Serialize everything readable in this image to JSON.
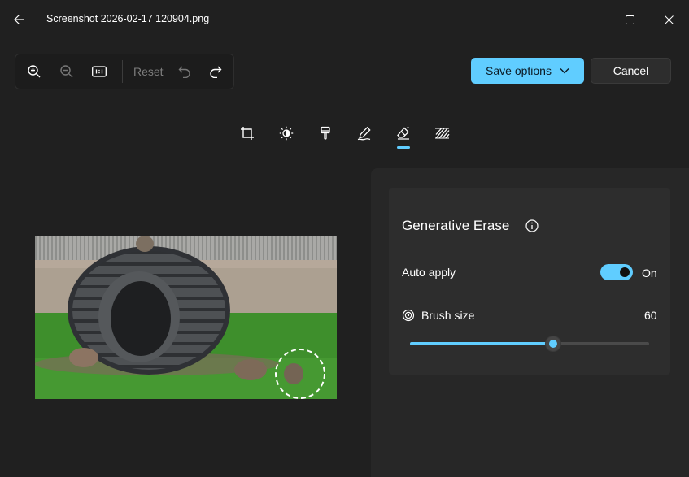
{
  "window": {
    "title": "Screenshot 2026-02-17 120904.png"
  },
  "toolbar": {
    "reset_label": "Reset"
  },
  "actions": {
    "save_label": "Save options",
    "cancel_label": "Cancel"
  },
  "tools": [
    {
      "icon": "crop-icon"
    },
    {
      "icon": "adjust-brightness-icon"
    },
    {
      "icon": "filter-brush-icon"
    },
    {
      "icon": "markup-pen-icon"
    },
    {
      "icon": "generative-erase-icon",
      "selected": true
    },
    {
      "icon": "background-blur-icon"
    }
  ],
  "panel": {
    "title": "Generative Erase",
    "auto_apply": {
      "label": "Auto apply",
      "state": "On",
      "on": true
    },
    "brush_size": {
      "label": "Brush size",
      "value": "60",
      "min": 0,
      "max": 100,
      "current": 60
    }
  },
  "colors": {
    "accent": "#60cdff",
    "background": "#202020",
    "panel": "#272727",
    "card": "#2d2d2d"
  }
}
